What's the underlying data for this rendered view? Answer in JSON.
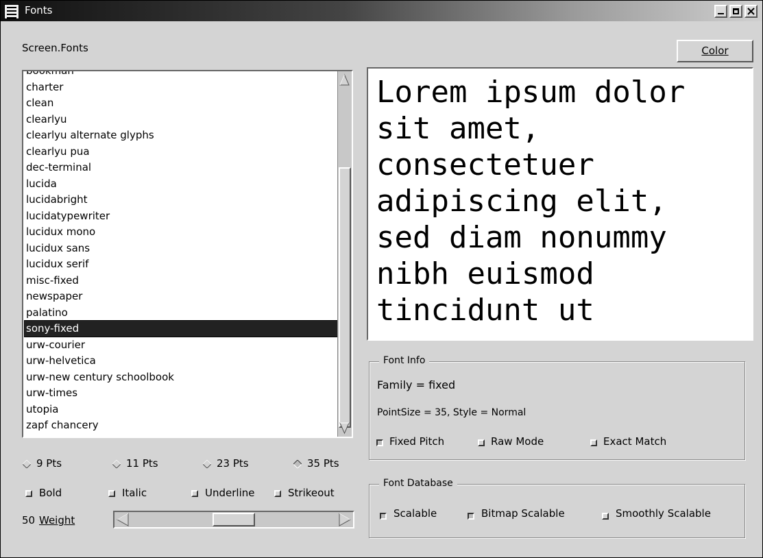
{
  "window": {
    "title": "Fonts"
  },
  "header": {
    "screen_fonts_label": "Screen.Fonts",
    "color_button": "Color"
  },
  "font_list": {
    "items": [
      "bookman",
      "charter",
      "clean",
      "clearlyu",
      "clearlyu alternate glyphs",
      "clearlyu pua",
      "dec-terminal",
      "lucida",
      "lucidabright",
      "lucidatypewriter",
      "lucidux mono",
      "lucidux sans",
      "lucidux serif",
      "misc-fixed",
      "newspaper",
      "palatino",
      "sony-fixed",
      "urw-courier",
      "urw-helvetica",
      "urw-new century schoolbook",
      "urw-times",
      "utopia",
      "zapf chancery"
    ],
    "selected": "sony-fixed"
  },
  "preview": {
    "text": "Lorem ipsum dolor\nsit amet,\nconsectetuer\nadipiscing elit,\nsed diam nonummy\nnibh euismod\ntincidunt ut"
  },
  "sizes": [
    {
      "label": "9 Pts",
      "selected": false
    },
    {
      "label": "11 Pts",
      "selected": false
    },
    {
      "label": "23 Pts",
      "selected": false
    },
    {
      "label": "35 Pts",
      "selected": true
    }
  ],
  "styles": {
    "bold": "Bold",
    "italic": "Italic",
    "underline": "Underline",
    "strikeout": "Strikeout"
  },
  "weight": {
    "value": "50",
    "label": "Weight",
    "fraction": 0.5
  },
  "font_info": {
    "title": "Font Info",
    "family": "Family = fixed",
    "point_size": "PointSize = 35, Style = Normal",
    "fixed_pitch": "Fixed Pitch",
    "raw_mode": "Raw Mode",
    "exact_match": "Exact Match"
  },
  "font_database": {
    "title": "Font Database",
    "scalable": "Scalable",
    "bitmap_scalable": "Bitmap Scalable",
    "smoothly_scalable": "Smoothly Scalable"
  },
  "colors": {
    "selection_bg": "#222222",
    "window_bg": "#d4d4d4"
  }
}
